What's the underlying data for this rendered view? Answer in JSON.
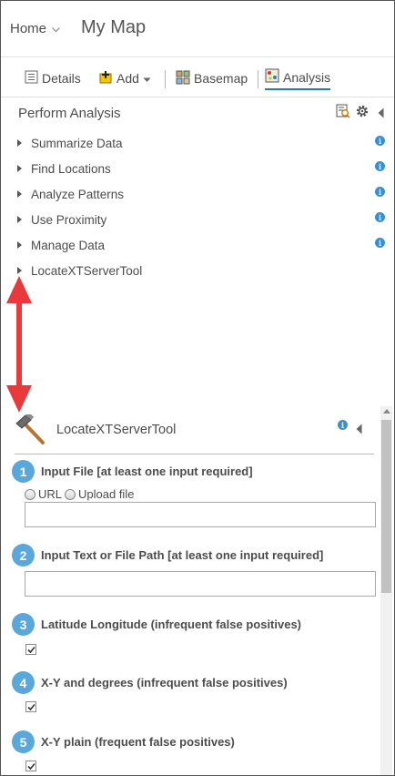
{
  "header": {
    "home_label": "Home",
    "map_title": "My Map"
  },
  "toolbar": {
    "details_label": "Details",
    "add_label": "Add",
    "basemap_label": "Basemap",
    "analysis_label": "Analysis"
  },
  "analysis_panel": {
    "title": "Perform Analysis",
    "categories": [
      {
        "label": "Summarize Data",
        "info": "i"
      },
      {
        "label": "Find Locations",
        "info": "i"
      },
      {
        "label": "Analyze Patterns",
        "info": "i"
      },
      {
        "label": "Use Proximity",
        "info": "i"
      },
      {
        "label": "Manage Data",
        "info": "i"
      },
      {
        "label": "LocateXTServerTool",
        "info": ""
      }
    ]
  },
  "tool_pane": {
    "title": "LocateXTServerTool",
    "info": "i",
    "steps": [
      {
        "number": "1",
        "label": "Input File [at least one input required]",
        "radio_url": "URL",
        "radio_upload": "Upload file",
        "value": ""
      },
      {
        "number": "2",
        "label": "Input Text or File Path [at least one input required]",
        "value": ""
      },
      {
        "number": "3",
        "label": "Latitude Longitude (infrequent false positives)",
        "checked": true
      },
      {
        "number": "4",
        "label": "X-Y and degrees (infrequent false positives)",
        "checked": true
      },
      {
        "number": "5",
        "label": "X-Y plain (frequent false positives)",
        "checked": true
      }
    ]
  },
  "colors": {
    "accent": "#1b7cc1",
    "step_badge": "#5aa7dc",
    "info_icon": "#3a8fd0",
    "annotation_arrow": "#e8393b"
  },
  "icons": [
    "chevron-down-icon",
    "details-icon",
    "add-icon",
    "basemap-icon",
    "analysis-icon",
    "history-icon",
    "gear-icon",
    "collapse-icon",
    "info-icon",
    "hammer-icon",
    "double-arrow-icon"
  ]
}
